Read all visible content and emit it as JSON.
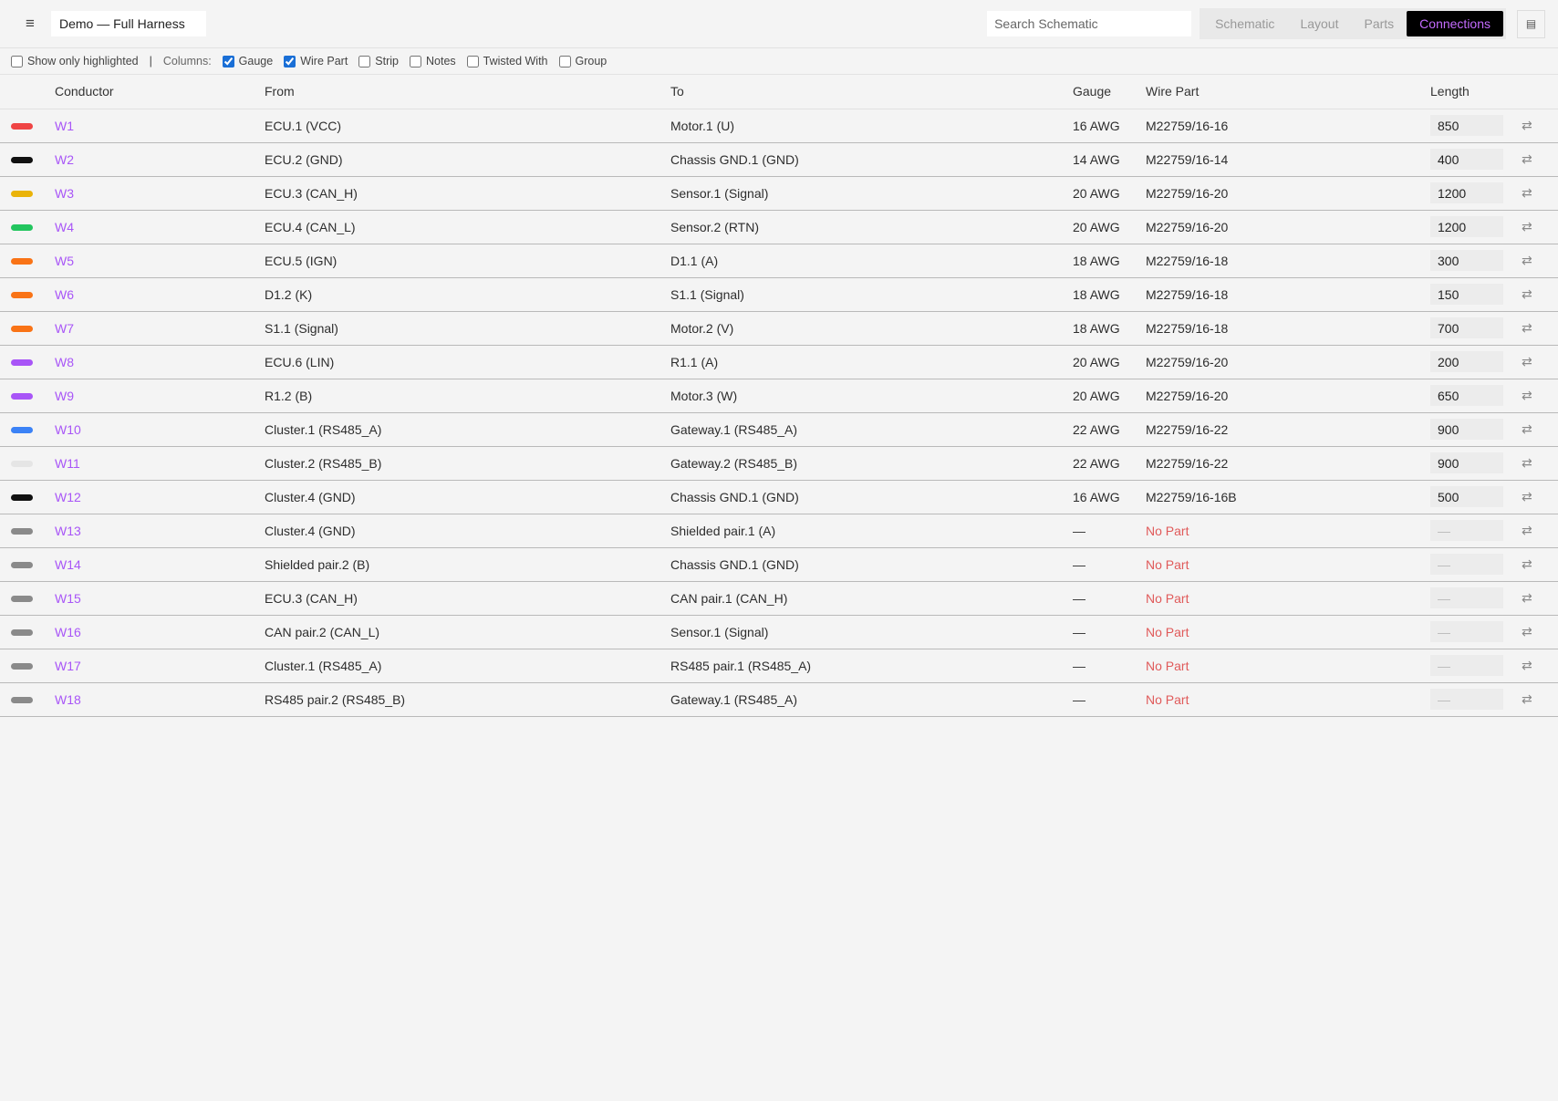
{
  "header": {
    "project_name": "Demo — Full Harness",
    "search_placeholder": "Search Schematic",
    "tabs": [
      {
        "label": "Schematic",
        "active": false
      },
      {
        "label": "Layout",
        "active": false
      },
      {
        "label": "Parts",
        "active": false
      },
      {
        "label": "Connections",
        "active": true
      }
    ],
    "menu_icon": "hamburger-icon",
    "panel_icon": "panel-toggle-icon"
  },
  "options": {
    "show_only_highlighted": {
      "label": "Show only highlighted",
      "checked": false
    },
    "separator": "|",
    "columns_label": "Columns:",
    "columns": [
      {
        "label": "Gauge",
        "checked": true
      },
      {
        "label": "Wire Part",
        "checked": true
      },
      {
        "label": "Strip",
        "checked": false
      },
      {
        "label": "Notes",
        "checked": false
      },
      {
        "label": "Twisted With",
        "checked": false
      },
      {
        "label": "Group",
        "checked": false
      }
    ]
  },
  "table": {
    "headers": {
      "conductor": "Conductor",
      "from": "From",
      "to": "To",
      "gauge": "Gauge",
      "wire_part": "Wire Part",
      "length": "Length"
    },
    "swap_glyph": "⇄",
    "rows": [
      {
        "color": "#ef4444",
        "conductor": "W1",
        "from": "ECU.1 (VCC)",
        "to": "Motor.1 (U)",
        "gauge": "16 AWG",
        "wire_part": "M22759/16-16",
        "length": "850",
        "no_part": false
      },
      {
        "color": "#111111",
        "conductor": "W2",
        "from": "ECU.2 (GND)",
        "to": "Chassis GND.1 (GND)",
        "gauge": "14 AWG",
        "wire_part": "M22759/16-14",
        "length": "400",
        "no_part": false
      },
      {
        "color": "#eab308",
        "conductor": "W3",
        "from": "ECU.3 (CAN_H)",
        "to": "Sensor.1 (Signal)",
        "gauge": "20 AWG",
        "wire_part": "M22759/16-20",
        "length": "1200",
        "no_part": false
      },
      {
        "color": "#22c55e",
        "conductor": "W4",
        "from": "ECU.4 (CAN_L)",
        "to": "Sensor.2 (RTN)",
        "gauge": "20 AWG",
        "wire_part": "M22759/16-20",
        "length": "1200",
        "no_part": false
      },
      {
        "color": "#f97316",
        "conductor": "W5",
        "from": "ECU.5 (IGN)",
        "to": "D1.1 (A)",
        "gauge": "18 AWG",
        "wire_part": "M22759/16-18",
        "length": "300",
        "no_part": false
      },
      {
        "color": "#f97316",
        "conductor": "W6",
        "from": "D1.2 (K)",
        "to": "S1.1 (Signal)",
        "gauge": "18 AWG",
        "wire_part": "M22759/16-18",
        "length": "150",
        "no_part": false
      },
      {
        "color": "#f97316",
        "conductor": "W7",
        "from": "S1.1 (Signal)",
        "to": "Motor.2 (V)",
        "gauge": "18 AWG",
        "wire_part": "M22759/16-18",
        "length": "700",
        "no_part": false
      },
      {
        "color": "#a855f7",
        "conductor": "W8",
        "from": "ECU.6 (LIN)",
        "to": "R1.1 (A)",
        "gauge": "20 AWG",
        "wire_part": "M22759/16-20",
        "length": "200",
        "no_part": false
      },
      {
        "color": "#a855f7",
        "conductor": "W9",
        "from": "R1.2 (B)",
        "to": "Motor.3 (W)",
        "gauge": "20 AWG",
        "wire_part": "M22759/16-20",
        "length": "650",
        "no_part": false
      },
      {
        "color": "#3b82f6",
        "conductor": "W10",
        "from": "Cluster.1 (RS485_A)",
        "to": "Gateway.1 (RS485_A)",
        "gauge": "22 AWG",
        "wire_part": "M22759/16-22",
        "length": "900",
        "no_part": false
      },
      {
        "color": "#e5e5e5",
        "conductor": "W11",
        "from": "Cluster.2 (RS485_B)",
        "to": "Gateway.2 (RS485_B)",
        "gauge": "22 AWG",
        "wire_part": "M22759/16-22",
        "length": "900",
        "no_part": false
      },
      {
        "color": "#111111",
        "conductor": "W12",
        "from": "Cluster.4 (GND)",
        "to": "Chassis GND.1 (GND)",
        "gauge": "16 AWG",
        "wire_part": "M22759/16-16B",
        "length": "500",
        "no_part": false
      },
      {
        "color": "#8a8a8a",
        "conductor": "W13",
        "from": "Cluster.4 (GND)",
        "to": "Shielded pair.1 (A)",
        "gauge": "—",
        "wire_part": "No Part",
        "length": "—",
        "no_part": true
      },
      {
        "color": "#8a8a8a",
        "conductor": "W14",
        "from": "Shielded pair.2 (B)",
        "to": "Chassis GND.1 (GND)",
        "gauge": "—",
        "wire_part": "No Part",
        "length": "—",
        "no_part": true
      },
      {
        "color": "#8a8a8a",
        "conductor": "W15",
        "from": "ECU.3 (CAN_H)",
        "to": "CAN pair.1 (CAN_H)",
        "gauge": "—",
        "wire_part": "No Part",
        "length": "—",
        "no_part": true
      },
      {
        "color": "#8a8a8a",
        "conductor": "W16",
        "from": "CAN pair.2 (CAN_L)",
        "to": "Sensor.1 (Signal)",
        "gauge": "—",
        "wire_part": "No Part",
        "length": "—",
        "no_part": true
      },
      {
        "color": "#8a8a8a",
        "conductor": "W17",
        "from": "Cluster.1 (RS485_A)",
        "to": "RS485 pair.1 (RS485_A)",
        "gauge": "—",
        "wire_part": "No Part",
        "length": "—",
        "no_part": true
      },
      {
        "color": "#8a8a8a",
        "conductor": "W18",
        "from": "RS485 pair.2 (RS485_B)",
        "to": "Gateway.1 (RS485_A)",
        "gauge": "—",
        "wire_part": "No Part",
        "length": "—",
        "no_part": true
      }
    ]
  }
}
